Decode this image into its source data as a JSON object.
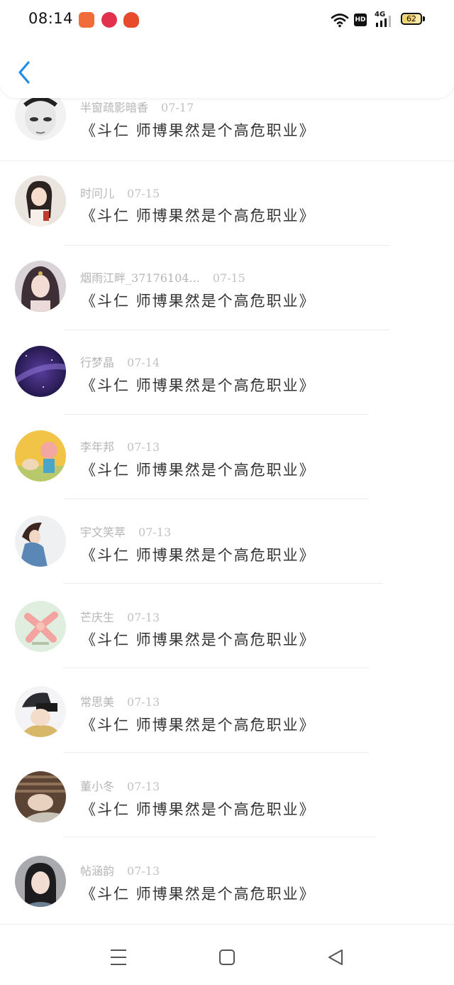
{
  "status_bar": {
    "time": "08:14",
    "network": "4G",
    "hd": "HD",
    "battery": "62",
    "battery_level": 0.62
  },
  "header": {
    "back_icon": "chevron-left-icon"
  },
  "comments": [
    {
      "name": "半窗疏影暗香",
      "date": "07-17",
      "text": "《斗仁 师博果然是个高危职业》"
    },
    {
      "name": "时问儿",
      "date": "07-15",
      "text": "《斗仁 师博果然是个高危职业》"
    },
    {
      "name": "烟雨江畔_37176104...",
      "date": "07-15",
      "text": "《斗仁 师博果然是个高危职业》"
    },
    {
      "name": "行梦晶",
      "date": "07-14",
      "text": "《斗仁 师博果然是个高危职业》"
    },
    {
      "name": "李年邦",
      "date": "07-13",
      "text": "《斗仁 师博果然是个高危职业》"
    },
    {
      "name": "宇文笑萃",
      "date": "07-13",
      "text": "《斗仁 师博果然是个高危职业》"
    },
    {
      "name": "芒庆生",
      "date": "07-13",
      "text": "《斗仁 师博果然是个高危职业》"
    },
    {
      "name": "常思美",
      "date": "07-13",
      "text": "《斗仁 师博果然是个高危职业》"
    },
    {
      "name": "董小冬",
      "date": "07-13",
      "text": "《斗仁 师博果然是个高危职业》"
    },
    {
      "name": "帖涵韵",
      "date": "07-13",
      "text": "《斗仁 师博果然是个高危职业》"
    }
  ],
  "colors": {
    "accent": "#1e8ee8",
    "name_text": "#b5b5b5",
    "comment_text": "#333333",
    "divider": "#ececec"
  },
  "nav": {
    "menu_icon": "menu-icon",
    "home_icon": "home-square-icon",
    "back_icon": "back-triangle-icon"
  }
}
